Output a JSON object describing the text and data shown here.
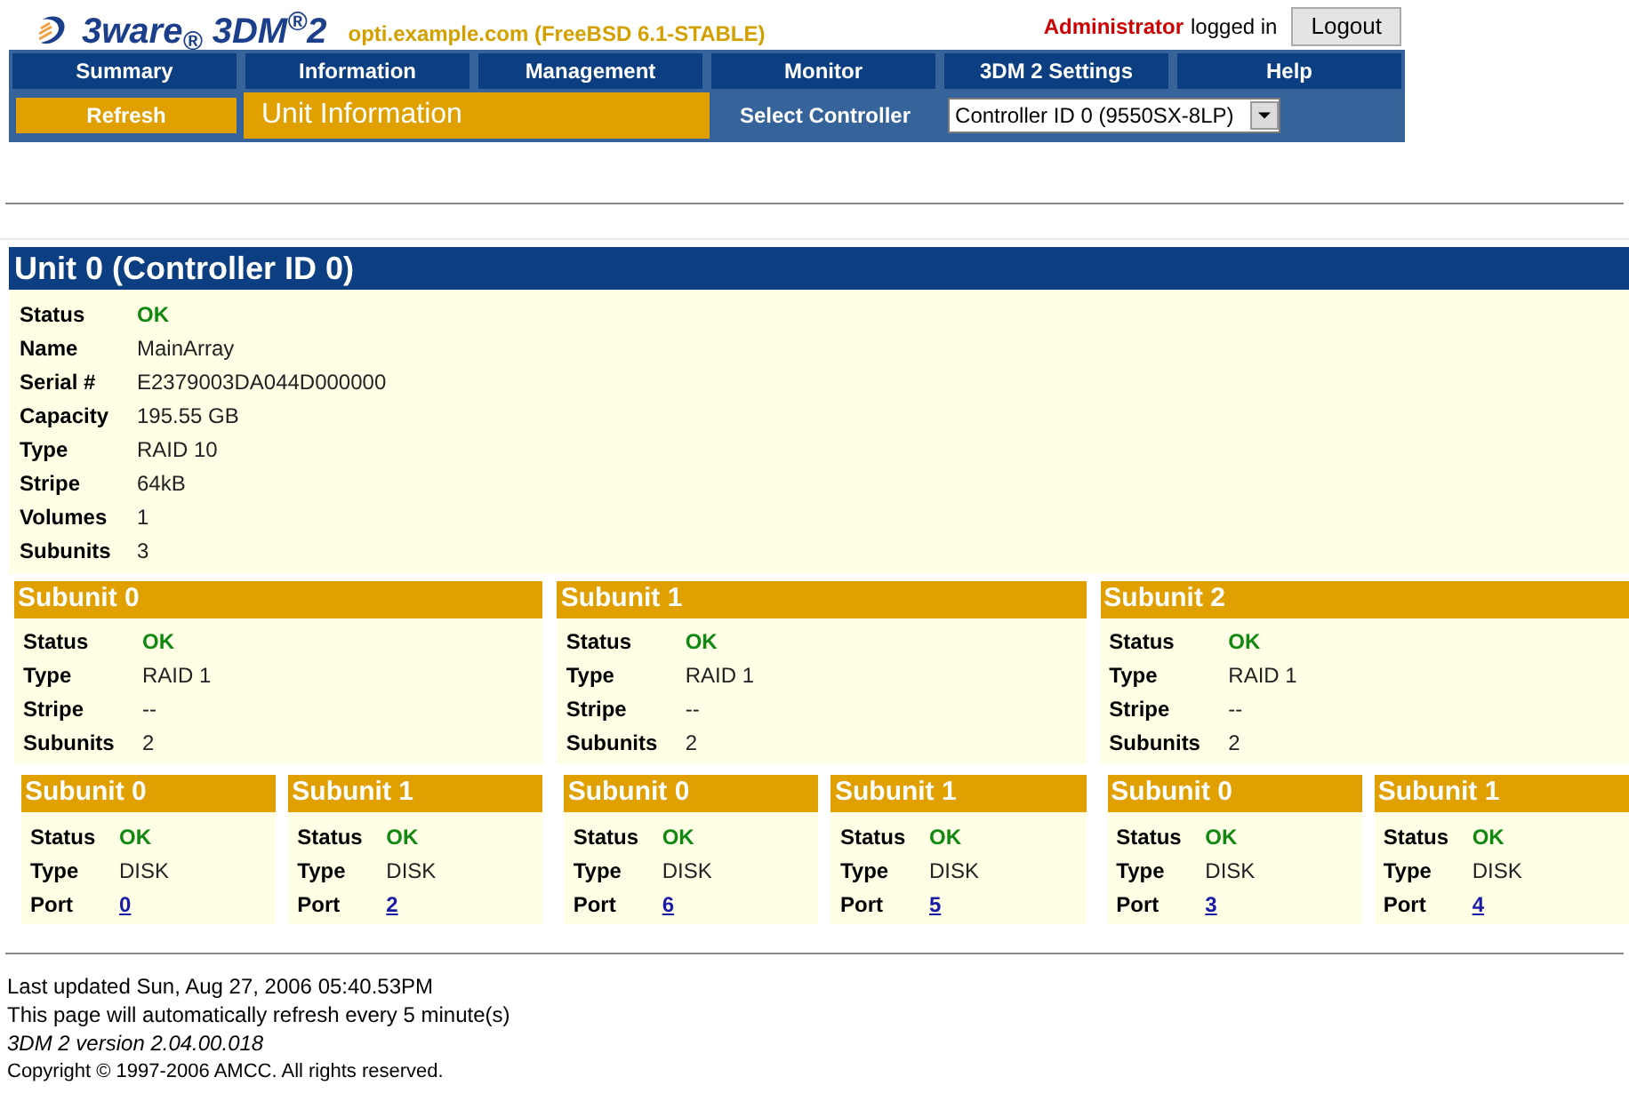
{
  "header": {
    "logo": "3ware$_{®}$ 3DM$^{®}$2",
    "host": "opti.example.com (FreeBSD 6.1-STABLE)",
    "user": "Administrator",
    "logged_in": "logged in",
    "logout": "Logout"
  },
  "nav": {
    "tabs": [
      {
        "label": "Summary"
      },
      {
        "label": "Information"
      },
      {
        "label": "Management"
      },
      {
        "label": "Monitor"
      },
      {
        "label": "3DM 2 Settings"
      },
      {
        "label": "Help"
      }
    ],
    "refresh": "Refresh",
    "page_title": "Unit Information",
    "select_label": "Select Controller",
    "select_value": "Controller ID 0 (9550SX-8LP)"
  },
  "unit": {
    "title": "Unit 0 (Controller ID 0)",
    "fields": [
      {
        "label": "Status",
        "value": "OK",
        "kind": "status"
      },
      {
        "label": "Name",
        "value": "MainArray",
        "kind": "text"
      },
      {
        "label": "Serial #",
        "value": "E2379003DA044D000000",
        "kind": "text"
      },
      {
        "label": "Capacity",
        "value": "195.55 GB",
        "kind": "text"
      },
      {
        "label": "Type",
        "value": "RAID 10",
        "kind": "text"
      },
      {
        "label": "Stripe",
        "value": "64kB",
        "kind": "text"
      },
      {
        "label": "Volumes",
        "value": "1",
        "kind": "text"
      },
      {
        "label": "Subunits",
        "value": "3",
        "kind": "text"
      }
    ],
    "subunits": [
      {
        "title": "Subunit 0",
        "fields": [
          {
            "label": "Status",
            "value": "OK",
            "kind": "status"
          },
          {
            "label": "Type",
            "value": "RAID 1",
            "kind": "text"
          },
          {
            "label": "Stripe",
            "value": "--",
            "kind": "text"
          },
          {
            "label": "Subunits",
            "value": "2",
            "kind": "text"
          }
        ],
        "subunits": [
          {
            "title": "Subunit 0",
            "fields": [
              {
                "label": "Status",
                "value": "OK",
                "kind": "status"
              },
              {
                "label": "Type",
                "value": "DISK",
                "kind": "text"
              },
              {
                "label": "Port",
                "value": "0",
                "kind": "link"
              }
            ]
          },
          {
            "title": "Subunit 1",
            "fields": [
              {
                "label": "Status",
                "value": "OK",
                "kind": "status"
              },
              {
                "label": "Type",
                "value": "DISK",
                "kind": "text"
              },
              {
                "label": "Port",
                "value": "2",
                "kind": "link"
              }
            ]
          }
        ]
      },
      {
        "title": "Subunit 1",
        "fields": [
          {
            "label": "Status",
            "value": "OK",
            "kind": "status"
          },
          {
            "label": "Type",
            "value": "RAID 1",
            "kind": "text"
          },
          {
            "label": "Stripe",
            "value": "--",
            "kind": "text"
          },
          {
            "label": "Subunits",
            "value": "2",
            "kind": "text"
          }
        ],
        "subunits": [
          {
            "title": "Subunit 0",
            "fields": [
              {
                "label": "Status",
                "value": "OK",
                "kind": "status"
              },
              {
                "label": "Type",
                "value": "DISK",
                "kind": "text"
              },
              {
                "label": "Port",
                "value": "6",
                "kind": "link"
              }
            ]
          },
          {
            "title": "Subunit 1",
            "fields": [
              {
                "label": "Status",
                "value": "OK",
                "kind": "status"
              },
              {
                "label": "Type",
                "value": "DISK",
                "kind": "text"
              },
              {
                "label": "Port",
                "value": "5",
                "kind": "link"
              }
            ]
          }
        ]
      },
      {
        "title": "Subunit 2",
        "fields": [
          {
            "label": "Status",
            "value": "OK",
            "kind": "status"
          },
          {
            "label": "Type",
            "value": "RAID 1",
            "kind": "text"
          },
          {
            "label": "Stripe",
            "value": "--",
            "kind": "text"
          },
          {
            "label": "Subunits",
            "value": "2",
            "kind": "text"
          }
        ],
        "subunits": [
          {
            "title": "Subunit 0",
            "fields": [
              {
                "label": "Status",
                "value": "OK",
                "kind": "status"
              },
              {
                "label": "Type",
                "value": "DISK",
                "kind": "text"
              },
              {
                "label": "Port",
                "value": "3",
                "kind": "link"
              }
            ]
          },
          {
            "title": "Subunit 1",
            "fields": [
              {
                "label": "Status",
                "value": "OK",
                "kind": "status"
              },
              {
                "label": "Type",
                "value": "DISK",
                "kind": "text"
              },
              {
                "label": "Port",
                "value": "4",
                "kind": "link"
              }
            ]
          }
        ]
      }
    ]
  },
  "footer": {
    "last_updated": "Last updated Sun, Aug 27, 2006 05:40.53PM",
    "refresh_note": "This page will automatically refresh every 5 minute(s)",
    "version": "3DM 2 version 2.04.00.018",
    "copyright": "Copyright © 1997-2006 AMCC. All rights reserved."
  }
}
